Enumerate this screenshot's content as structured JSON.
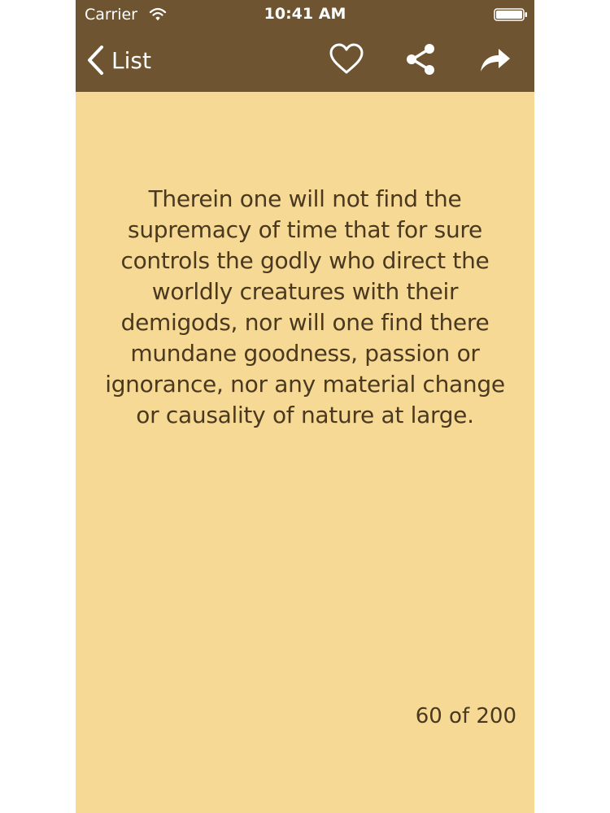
{
  "status_bar": {
    "carrier": "Carrier",
    "time": "10:41 AM",
    "wifi_icon": "wifi-icon",
    "battery_icon": "battery-icon"
  },
  "nav": {
    "back_label": "List",
    "back_icon": "chevron-left-icon",
    "favorite_icon": "heart-icon",
    "share_icon": "share-icon",
    "forward_icon": "forward-icon"
  },
  "content": {
    "quote": "Therein one will not find the supremacy of time that for sure controls the godly who direct the worldly creatures with their demigods, nor will one find there mundane goodness, passion or ignorance, nor any material change or causality of nature at large.",
    "counter": "60 of 200"
  },
  "colors": {
    "nav_background": "#6e5430",
    "page_background": "#f5d995",
    "text": "#4a381f",
    "nav_text": "#ffffff"
  }
}
